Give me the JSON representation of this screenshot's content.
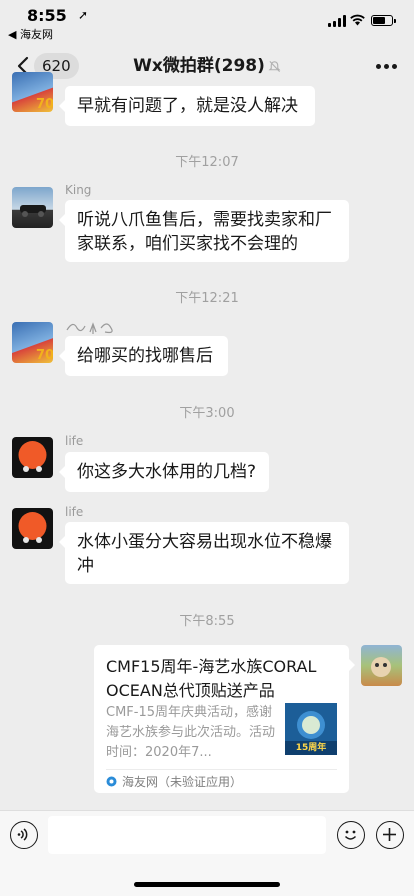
{
  "status_bar": {
    "time": "8:55",
    "back_app": "◀ 海友网"
  },
  "nav": {
    "back_count": "620",
    "title": "Wx微拍群(298)"
  },
  "messages": [
    {
      "text": "早就有问题了，就是没人解决"
    },
    {
      "timestamp": "下午12:07"
    },
    {
      "sender": "King",
      "text": "听说八爪鱼售后，需要找卖家和厂家联系，咱们买家找不会理的"
    },
    {
      "timestamp": "下午12:21"
    },
    {
      "sender": "",
      "text": "给哪买的找哪售后"
    },
    {
      "timestamp": "下午3:00"
    },
    {
      "sender": "life",
      "text": "你这多大水体用的几档?"
    },
    {
      "sender": "life",
      "text": "水体小蛋分大容易出现水位不稳爆冲"
    },
    {
      "timestamp": "下午8:55"
    }
  ],
  "card": {
    "title": "CMF15周年-海艺水族CORAL OCEAN总代顶贴送产品",
    "description": "CMF-15周年庆典活动，感谢海艺水族参与此次活动。活动时间：2020年7...",
    "thumb_label": "15周年",
    "source": "海友网（未验证应用）"
  },
  "colors": {
    "background": "#ededed",
    "bubble": "#ffffff",
    "timestamp": "#a0a0a0"
  },
  "icons": [
    "back-chevron-icon",
    "mute-icon",
    "more-icon",
    "voice-icon",
    "emoji-icon",
    "plus-icon"
  ]
}
